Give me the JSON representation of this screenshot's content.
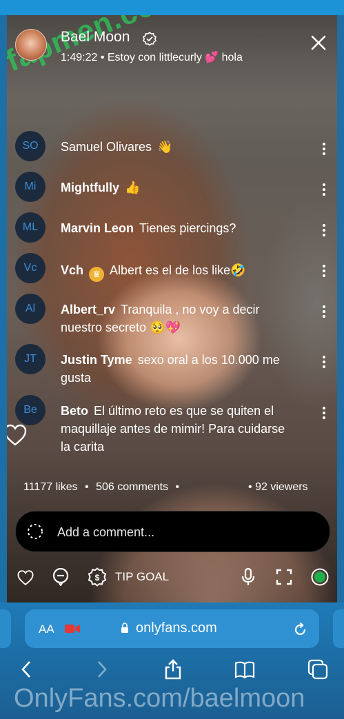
{
  "stream": {
    "creator_name": "Bael Moon",
    "meta": "1:49:22 • Estoy con littlecurly 💕 hola",
    "watermark_top": "fapmen.com",
    "colors": {
      "accent": "#1b93d6",
      "avatar_text": "#3c8dd6",
      "live_dot": "#1fae4a"
    }
  },
  "comments": [
    {
      "initials": "SO",
      "name": "Samuel Olivares",
      "text": "👋"
    },
    {
      "initials": "Mi",
      "name": "Mightfully",
      "text": "👍"
    },
    {
      "initials": "ML",
      "name": "Marvin Leon",
      "text": "Tienes piercings?"
    },
    {
      "initials": "Vc",
      "name": "Vch",
      "text": "Albert es el de los like🤣"
    },
    {
      "initials": "Al",
      "name": "Albert_rv",
      "text": "Tranquila , no voy a decir nuestro secreto 🥺💖"
    },
    {
      "initials": "JT",
      "name": "Justin Tyme",
      "text": "sexo oral a los 10.000 me gusta"
    },
    {
      "initials": "Be",
      "name": "Beto",
      "text": "El último reto es que se quiten el maquillaje antes de mimir! Para cuidarse la carita"
    }
  ],
  "stats": {
    "likes": "11177",
    "likes_label": "likes",
    "comments": "506",
    "comments_label": "comments",
    "viewers": "92",
    "viewers_label": "viewers"
  },
  "comment_input": {
    "placeholder": "Add a comment..."
  },
  "toolbar": {
    "tip_goal_label": "TIP GOAL"
  },
  "browser": {
    "aa_label": "AA",
    "url": "onlyfans.com",
    "watermark_bottom": "OnlyFans.com/baelmoon"
  }
}
